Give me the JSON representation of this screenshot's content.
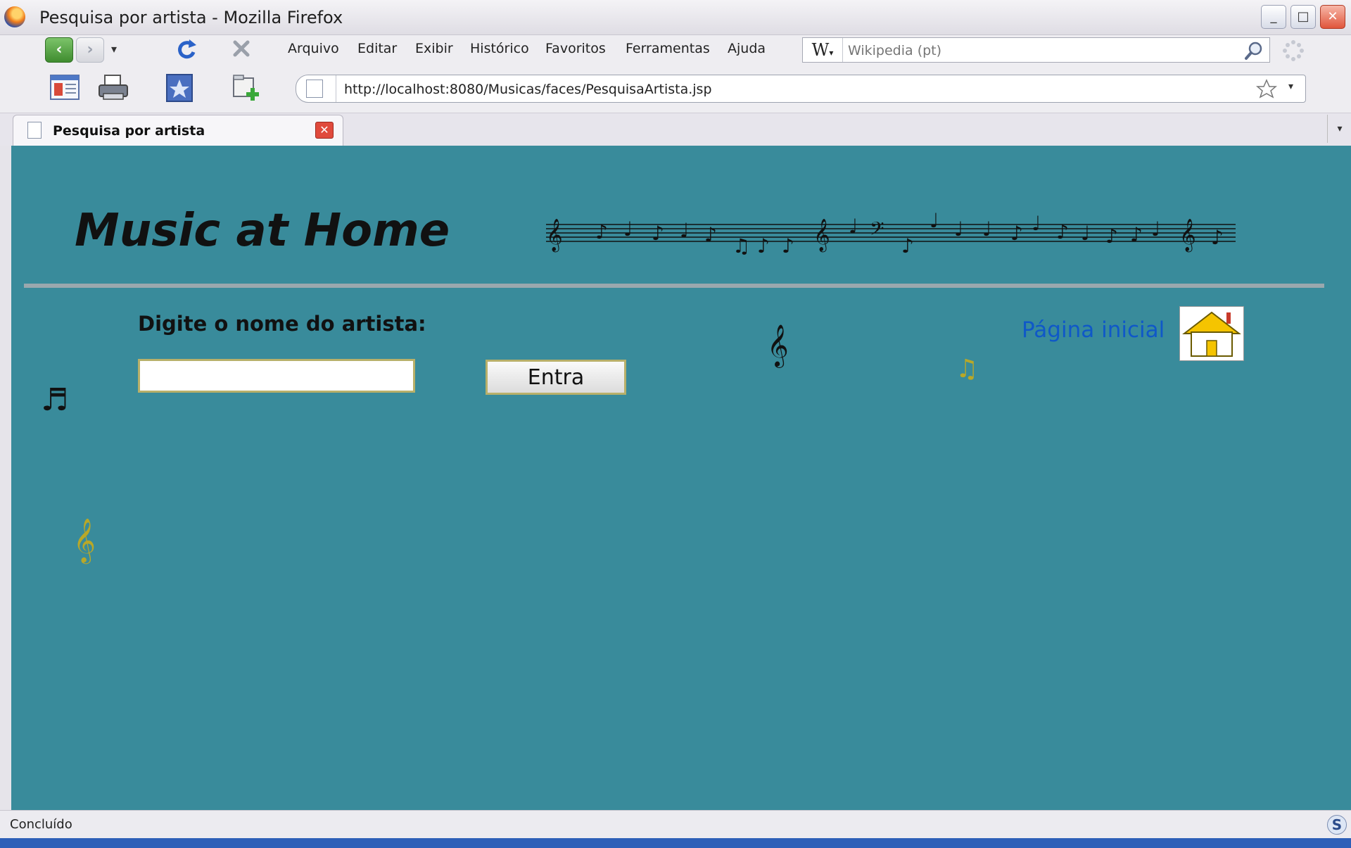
{
  "window": {
    "title": "Pesquisa por artista - Mozilla Firefox",
    "controls": {
      "minimize": "_",
      "maximize": "□",
      "close": "✕"
    }
  },
  "nav": {
    "back": "‹",
    "forward": "›",
    "dropdown": "▾"
  },
  "menu": {
    "items": [
      "Arquivo",
      "Editar",
      "Exibir",
      "Histórico",
      "Favoritos",
      "Ferramentas",
      "Ajuda"
    ]
  },
  "search": {
    "engine_label": "W",
    "placeholder": "Wikipedia (pt)"
  },
  "address": {
    "url": "http://localhost:8080/Musicas/faces/PesquisaArtista.jsp"
  },
  "tabs": [
    {
      "label": "Pesquisa por artista",
      "close": "✕"
    }
  ],
  "page": {
    "site_title": "Music at Home",
    "prompt": "Digite o nome do artista:",
    "artist_input_value": "",
    "submit_label": "Entra",
    "home_link": "Página inicial"
  },
  "status": {
    "text": "Concluído",
    "icon_label": "S"
  },
  "colors": {
    "page_background": "#398b9b",
    "link": "#0f58c8",
    "input_border": "#b8b06a"
  },
  "icons": [
    "firefox-logo-icon",
    "back-icon",
    "forward-icon",
    "reload-icon",
    "stop-icon",
    "bookmarks-sidebar-icon",
    "print-icon",
    "bookmark-star-icon",
    "new-tab-icon",
    "search-magnifier-icon",
    "page-icon",
    "home-icon",
    "music-note-icon"
  ]
}
